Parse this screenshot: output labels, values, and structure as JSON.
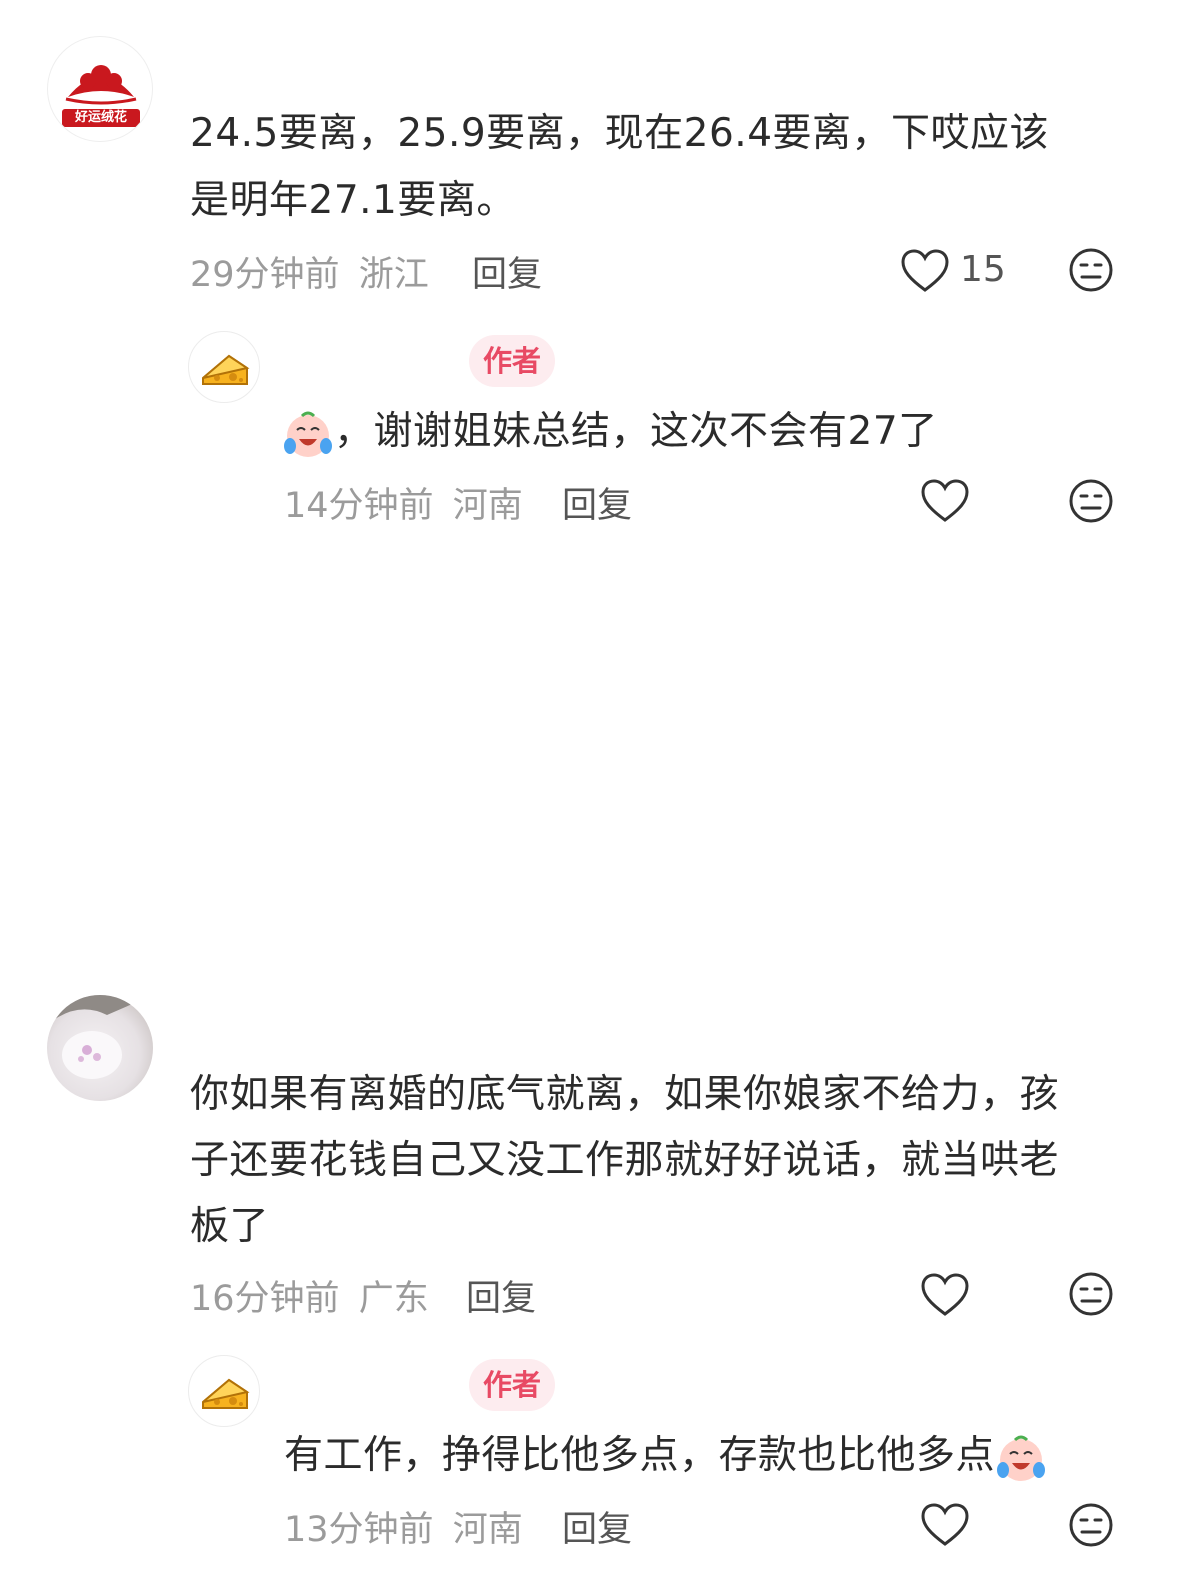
{
  "comments": [
    {
      "avatar_text": "好运绒花",
      "text_lines": [
        "24.5要离，25.9要离，现在26.4要离，下哎应该",
        "是明年27.1要离。"
      ],
      "time": "29分钟前",
      "location": "浙江",
      "reply_label": "回复",
      "like_count": "15",
      "replies": [
        {
          "author_badge": "作者",
          "text_prefix": "，谢谢姐妹总结，这次不会有27了",
          "time": "14分钟前",
          "location": "河南",
          "reply_label": "回复"
        }
      ]
    },
    {
      "text_lines": [
        "你如果有离婚的底气就离，如果你娘家不给力，孩",
        "子还要花钱自己又没工作那就好好说话，就当哄老",
        "板了"
      ],
      "time": "16分钟前",
      "location": "广东",
      "reply_label": "回复",
      "replies": [
        {
          "author_badge": "作者",
          "text_prefix": "有工作，挣得比他多点，存款也比他多点",
          "time": "13分钟前",
          "location": "河南",
          "reply_label": "回复"
        }
      ]
    }
  ],
  "icons": {
    "like": "heart-outline-icon",
    "dislike": "meh-face-icon",
    "emoji": "crying-laugh-emoji"
  },
  "colors": {
    "badge_bg": "#fdecef",
    "badge_text": "#e84a64",
    "meta": "#9b9b9b",
    "text": "#2b2b2b"
  }
}
